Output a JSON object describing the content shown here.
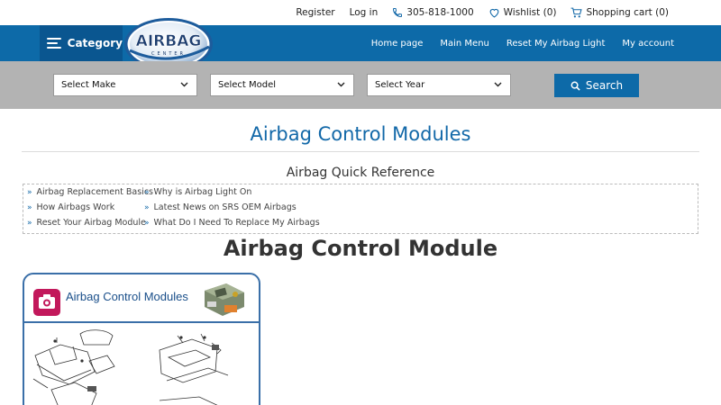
{
  "topbar": {
    "register": "Register",
    "login": "Log in",
    "phone": "305-818-1000",
    "wishlist": "Wishlist (0)",
    "cart": "Shopping cart (0)"
  },
  "nav": {
    "category": "Category",
    "links": [
      "Home page",
      "Main Menu",
      "Reset My Airbag Light",
      "My account"
    ]
  },
  "logo": {
    "text": "AIRBAG",
    "sub": "CENTER"
  },
  "search": {
    "make": "Select Make",
    "model": "Select Model",
    "year": "Select Year",
    "button": "Search"
  },
  "page": {
    "title": "Airbag Control Modules",
    "quick_ref_title": "Airbag Quick Reference",
    "quick_ref_items": [
      "Airbag Replacement Basics",
      "Why is Airbag Light On",
      "How Airbags Work",
      "Latest News on SRS OEM Airbags",
      "Reset Your Airbag Module",
      "What Do I Need To Replace My Airbags"
    ],
    "heading": "Airbag Control Module"
  },
  "diagram": {
    "title": "Airbag Control Modules"
  },
  "colors": {
    "primary": "#0d6aa8",
    "primary_dark": "#0a5690",
    "search_band": "#b3b3b3",
    "title_blue": "#1268a8"
  }
}
